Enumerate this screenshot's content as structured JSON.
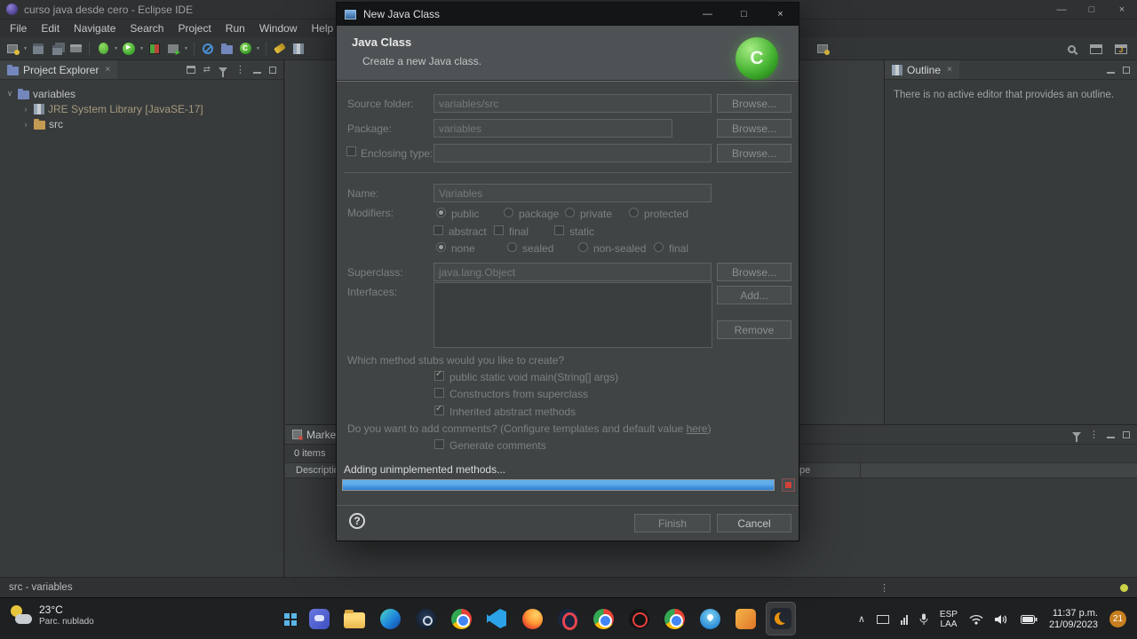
{
  "titlebar": {
    "title": "curso java desde cero - Eclipse IDE"
  },
  "menubar": {
    "items": [
      "File",
      "Edit",
      "Navigate",
      "Search",
      "Project",
      "Run",
      "Window",
      "Help"
    ]
  },
  "explorer": {
    "tab": "Project Explorer",
    "items": [
      {
        "label": "variables"
      },
      {
        "label": "JRE System Library [JavaSE-17]"
      },
      {
        "label": "src"
      }
    ]
  },
  "outline": {
    "tab": "Outline",
    "message": "There is no active editor that provides an outline."
  },
  "bottom": {
    "tab": "Marke",
    "items_count": "0 items",
    "col1": "Description",
    "col2": "pe"
  },
  "statusbar": {
    "text": "src - variables"
  },
  "dialog": {
    "title": "New Java Class",
    "banner": {
      "title": "Java Class",
      "subtitle": "Create a new Java class.",
      "logo_letter": "C"
    },
    "source_folder": {
      "label": "Source folder:",
      "value": "variables/src",
      "browse": "Browse..."
    },
    "package": {
      "label": "Package:",
      "value": "variables",
      "browse": "Browse..."
    },
    "enclosing": {
      "label": "Enclosing type:",
      "value": "",
      "browse": "Browse...",
      "checked": false
    },
    "name": {
      "label": "Name:",
      "value": "Variables"
    },
    "modifiers": {
      "label": "Modifiers:",
      "access": [
        {
          "label": "public",
          "selected": true
        },
        {
          "label": "package",
          "selected": false
        },
        {
          "label": "private",
          "selected": false
        },
        {
          "label": "protected",
          "selected": false
        }
      ],
      "flags": [
        {
          "label": "abstract",
          "checked": false
        },
        {
          "label": "final",
          "checked": false
        },
        {
          "label": "static",
          "checked": false
        }
      ],
      "sealing": [
        {
          "label": "none",
          "selected": true
        },
        {
          "label": "sealed",
          "selected": false
        },
        {
          "label": "non-sealed",
          "selected": false
        },
        {
          "label": "final",
          "selected": false
        }
      ]
    },
    "superclass": {
      "label": "Superclass:",
      "value": "java.lang.Object",
      "browse": "Browse..."
    },
    "interfaces": {
      "label": "Interfaces:",
      "add": "Add...",
      "remove": "Remove"
    },
    "stubs": {
      "question": "Which method stubs would you like to create?",
      "options": [
        {
          "label": "public static void main(String[] args)",
          "checked": true
        },
        {
          "label": "Constructors from superclass",
          "checked": false
        },
        {
          "label": "Inherited abstract methods",
          "checked": true
        }
      ]
    },
    "comments": {
      "prefix": "Do you want to add comments? (Configure templates and default value ",
      "link": "here",
      "suffix": ")",
      "option": {
        "label": "Generate comments",
        "checked": false
      }
    },
    "progress": {
      "text": "Adding unimplemented methods...",
      "percent": 100
    },
    "buttons": {
      "finish": "Finish",
      "cancel": "Cancel"
    },
    "help_glyph": "?"
  },
  "taskbar": {
    "weather": {
      "temp": "23°C",
      "condition": "Parc. nublado"
    },
    "tray": {
      "lang_top": "ESP",
      "lang_bottom": "LAA",
      "time": "11:37 p.m.",
      "date": "21/09/2023",
      "badge": "21"
    }
  },
  "icons": {
    "close": "×",
    "minimize": "—",
    "maximize": "□",
    "overflow": "⋮",
    "chevron_expanded": "∨",
    "chevron_collapsed": "›",
    "hidden_icons": "∧",
    "dropdown": "▼",
    "check": "✓"
  }
}
